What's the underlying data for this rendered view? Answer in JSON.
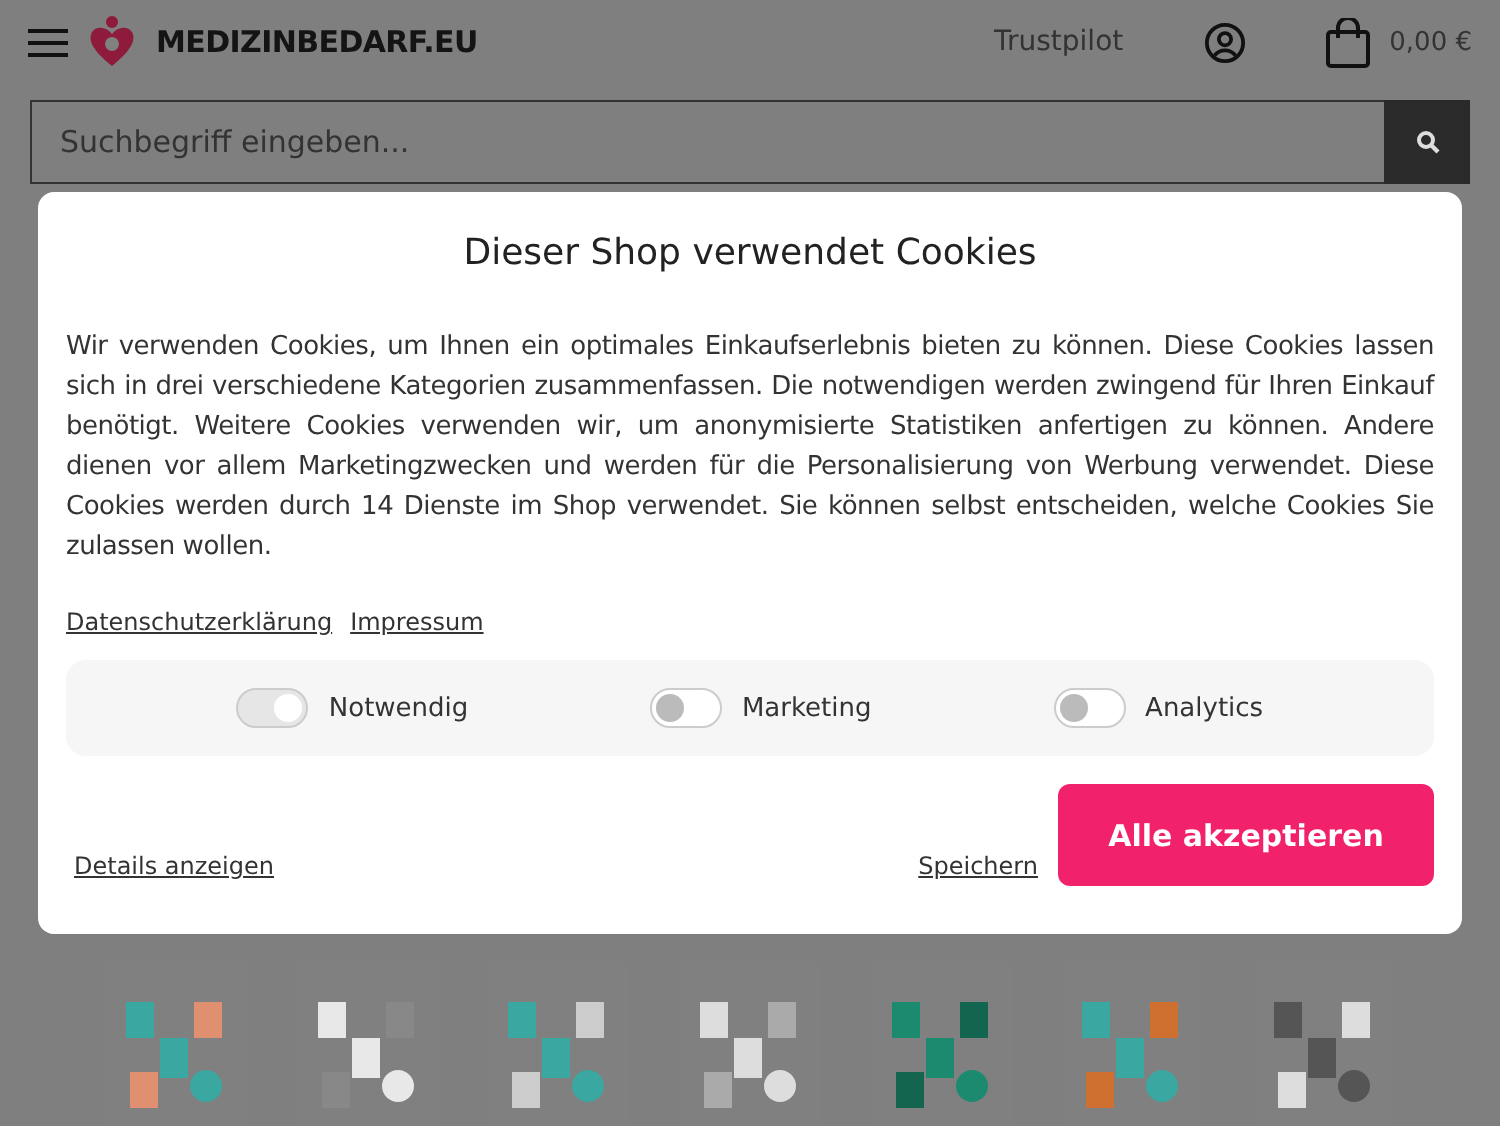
{
  "header": {
    "logo": "MEDIZINBEDARF.EU",
    "trustpilot": "Trustpilot",
    "cart_total": "0,00 €"
  },
  "search": {
    "placeholder": "Suchbegriff eingeben..."
  },
  "cookie_dialog": {
    "title": "Dieser Shop verwendet Cookies",
    "text": "Wir verwenden Cookies, um Ihnen ein optimales Einkaufserlebnis bieten zu können. Diese Cookies lassen sich in drei verschiedene Kategorien zusammenfassen. Die notwendigen werden zwingend für Ihren Einkauf benötigt. Weitere Cookies verwenden wir, um anonymisierte Statistiken anfertigen zu können. Andere dienen vor allem Marketingzwecken und werden für die Personalisierung von Werbung verwendet. Diese Cookies werden durch 14 Dienste im Shop verwendet. Sie können selbst entscheiden, welche Cookies Sie zulassen wollen.",
    "links": [
      "Datenschutzerklärung",
      "Impressum"
    ],
    "categories": [
      {
        "label": "Notwendig",
        "on": true,
        "disabled": true
      },
      {
        "label": "Marketing",
        "on": false,
        "disabled": false
      },
      {
        "label": "Analytics",
        "on": false,
        "disabled": false
      }
    ],
    "details_link": "Details anzeigen",
    "save_link": "Speichern",
    "accept_button": "Alle akzeptieren"
  }
}
